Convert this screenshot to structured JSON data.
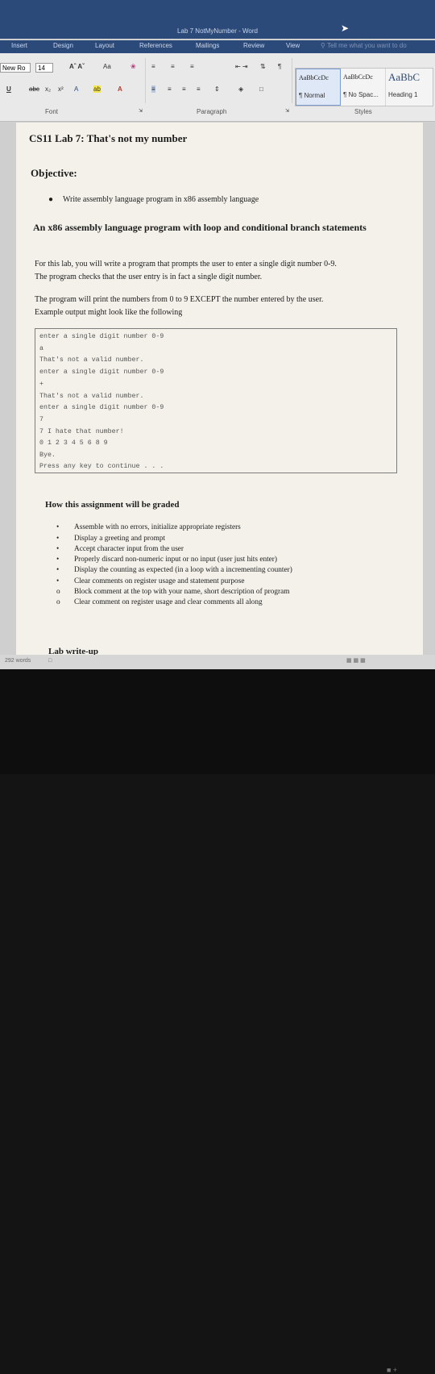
{
  "window": {
    "title": "Lab 7 NotMyNumber - Word"
  },
  "tabs": [
    "Insert",
    "Design",
    "Layout",
    "References",
    "Mailings",
    "Review",
    "View"
  ],
  "tell_me": "Tell me what you want to do",
  "ribbon": {
    "font_name": "New Ro",
    "font_size": "14",
    "change_case": "Aa",
    "font_group": "Font",
    "paragraph_group": "Paragraph",
    "styles_group": "Styles",
    "styles": [
      {
        "sample": "AaBbCcDc",
        "label": "¶ Normal"
      },
      {
        "sample": "AaBbCcDc",
        "label": "¶ No Spac..."
      },
      {
        "sample": "AaBbC",
        "label": "Heading 1"
      }
    ]
  },
  "doc": {
    "title": "CS11 Lab 7:  That's not my number",
    "objective": "Objective:",
    "objective_bullet": "Write assembly language program in x86 assembly language",
    "heading": "An x86 assembly language program with loop and conditional branch statements",
    "para1_line1": "For this lab, you will write a program that prompts the user to enter a single digit number 0-9.",
    "para1_line2": "The program checks that the user entry is in fact a single digit number.",
    "para2_line1": "The program will print the numbers from 0 to 9 EXCEPT the number entered by the user.",
    "para2_line2": "Example output might look like the following",
    "code_lines": [
      "enter a single digit number 0-9",
      "a",
      "That's not a valid number.",
      "enter a single digit number 0-9",
      "+",
      "That's not a valid number.",
      "enter a single digit number 0-9",
      "7",
      "7 I hate that number!",
      "0 1 2 3 4 5 6 8 9",
      "Bye.",
      "Press any key to continue . . ."
    ],
    "grading_heading": "How this assignment will be graded",
    "grading_items": [
      {
        "marker": "•",
        "text": "Assemble with no errors, initialize appropriate registers"
      },
      {
        "marker": "•",
        "text": "Display a greeting and prompt"
      },
      {
        "marker": "•",
        "text": "Accept character input from the user"
      },
      {
        "marker": "•",
        "text": "Properly discard non-numeric input or no input (user just hits enter)"
      },
      {
        "marker": "•",
        "text": "Display the counting as expected (in a loop with a incrementing counter)"
      },
      {
        "marker": "•",
        "text": "Clear comments on register usage and statement purpose"
      },
      {
        "marker": "o",
        "text": "Block comment at the top with your name, short description of program"
      },
      {
        "marker": "o",
        "text": "Clear comment on register usage and clear comments all along"
      }
    ],
    "writeup": "Lab write-up"
  },
  "status": {
    "word_count": "292 words"
  }
}
